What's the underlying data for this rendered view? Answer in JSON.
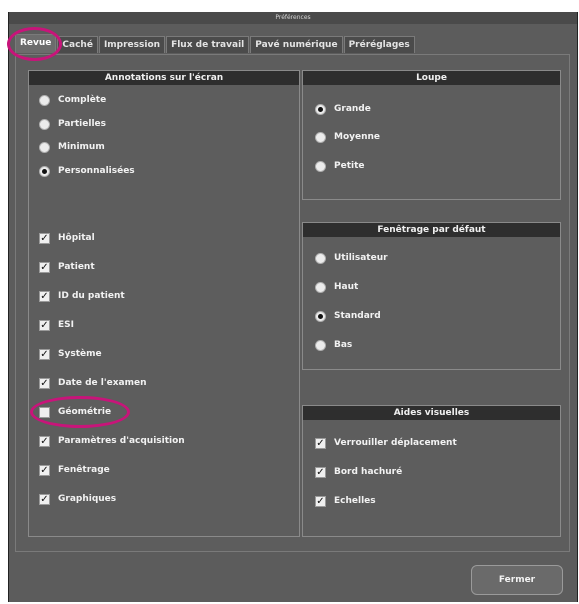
{
  "window": {
    "title": "Préférences"
  },
  "tabs": [
    {
      "label": "Revue",
      "active": true
    },
    {
      "label": "Caché",
      "active": false
    },
    {
      "label": "Impression",
      "active": false
    },
    {
      "label": "Flux de travail",
      "active": false
    },
    {
      "label": "Pavé numérique",
      "active": false
    },
    {
      "label": "Préréglages",
      "active": false
    }
  ],
  "annotations": {
    "header": "Annotations sur l'écran",
    "radio_options": [
      {
        "label": "Complète",
        "selected": false
      },
      {
        "label": "Partielles",
        "selected": false
      },
      {
        "label": "Minimum",
        "selected": false
      },
      {
        "label": "Personnalisées",
        "selected": true
      }
    ],
    "checkbox_options": [
      {
        "label": "Hôpital",
        "checked": true
      },
      {
        "label": "Patient",
        "checked": true
      },
      {
        "label": "ID du patient",
        "checked": true
      },
      {
        "label": "ESI",
        "checked": true
      },
      {
        "label": "Système",
        "checked": true
      },
      {
        "label": "Date de l'examen",
        "checked": true
      },
      {
        "label": "Géométrie",
        "checked": false
      },
      {
        "label": "Paramètres d'acquisition",
        "checked": true
      },
      {
        "label": "Fenêtrage",
        "checked": true
      },
      {
        "label": "Graphiques",
        "checked": true
      }
    ]
  },
  "loupe": {
    "header": "Loupe",
    "options": [
      {
        "label": "Grande",
        "selected": true
      },
      {
        "label": "Moyenne",
        "selected": false
      },
      {
        "label": "Petite",
        "selected": false
      }
    ]
  },
  "fenetrage": {
    "header": "Fenêtrage par défaut",
    "options": [
      {
        "label": "Utilisateur",
        "selected": false
      },
      {
        "label": "Haut",
        "selected": false
      },
      {
        "label": "Standard",
        "selected": true
      },
      {
        "label": "Bas",
        "selected": false
      }
    ]
  },
  "aides": {
    "header": "Aides visuelles",
    "options": [
      {
        "label": "Verrouiller déplacement",
        "checked": true
      },
      {
        "label": "Bord hachuré",
        "checked": true
      },
      {
        "label": "Echelles",
        "checked": true
      }
    ]
  },
  "footer": {
    "close_label": "Fermer"
  },
  "colors": {
    "highlight": "#c8147a",
    "window_bg": "#5c5c5c",
    "header_bg": "#2e2e2e"
  }
}
